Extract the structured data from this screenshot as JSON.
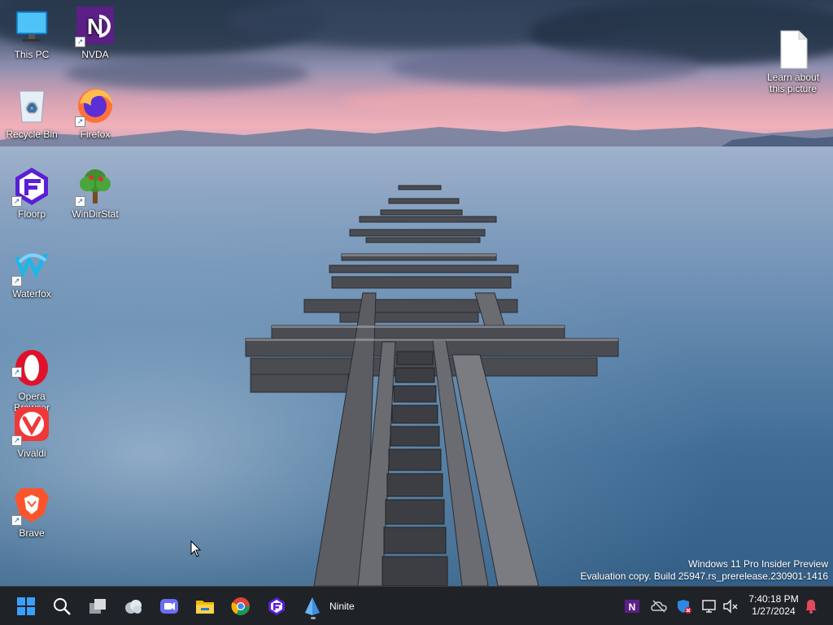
{
  "desktop": {
    "icons": [
      {
        "label": "This PC",
        "icon": "monitor-icon"
      },
      {
        "label": "NVDA",
        "icon": "nvda-icon"
      },
      {
        "label": "Recycle Bin",
        "icon": "recycle-bin-icon"
      },
      {
        "label": "Firefox",
        "icon": "firefox-icon"
      },
      {
        "label": "Floorp",
        "icon": "floorp-icon"
      },
      {
        "label": "WinDirStat",
        "icon": "windirstat-icon"
      },
      {
        "label": "Waterfox",
        "icon": "waterfox-icon"
      },
      {
        "label": "Opera\nBrowser",
        "icon": "opera-icon"
      },
      {
        "label": "Vivaldi",
        "icon": "vivaldi-icon"
      },
      {
        "label": "Brave",
        "icon": "brave-icon"
      },
      {
        "label": "Learn about\nthis picture",
        "icon": "document-icon"
      }
    ]
  },
  "watermark": {
    "line1": "Windows 11 Pro Insider Preview",
    "line2": "Evaluation copy. Build 25947.rs_prerelease.230901-1416"
  },
  "taskbar": {
    "items": [
      "start-icon",
      "search-icon",
      "task-view-icon",
      "widgets-icon",
      "teams-chat-icon",
      "file-explorer-icon",
      "chrome-icon",
      "floorp-icon",
      "ninite-icon"
    ],
    "active_app_label": "Ninite",
    "tray": [
      "nvda-tray-icon",
      "onedrive-icon",
      "windows-security-icon",
      "network-icon",
      "volume-muted-icon"
    ],
    "time": "7:40:18 PM",
    "date": "1/27/2024",
    "notification_icon": "notification-bell-icon"
  },
  "colors": {
    "taskbar_bg": "#1f2227",
    "accent_blue": "#3aa0ff",
    "notification_badge": "#e14a5b"
  }
}
